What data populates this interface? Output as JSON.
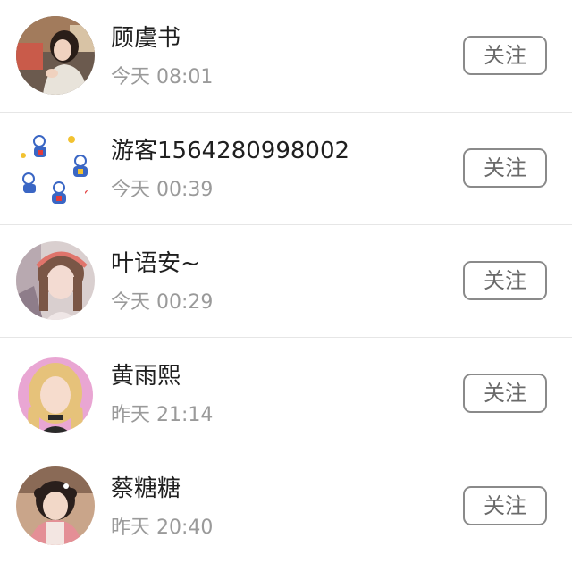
{
  "follow_list": {
    "items": [
      {
        "name": "顾虞书",
        "time": "今天 08:01",
        "button": "关注"
      },
      {
        "name": "游客1564280998002",
        "time": "今天 00:39",
        "button": "关注"
      },
      {
        "name": "叶语安~",
        "time": "今天 00:29",
        "button": "关注"
      },
      {
        "name": "黄雨熙",
        "time": "昨天 21:14",
        "button": "关注"
      },
      {
        "name": "蔡糖糖",
        "time": "昨天 20:40",
        "button": "关注"
      }
    ]
  },
  "colors": {
    "name_text": "#1f1f1f",
    "time_text": "#9a9a9a",
    "button_border": "#8a8a8a",
    "button_text": "#6a6a6a",
    "divider": "#e6e6e6"
  }
}
